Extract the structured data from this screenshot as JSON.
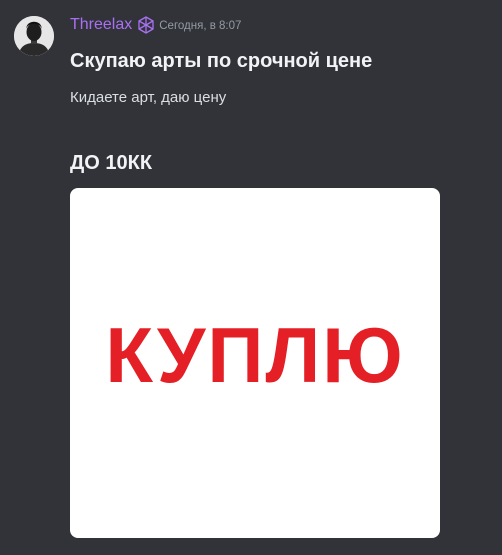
{
  "colors": {
    "background": "#313338",
    "username": "#a970f3",
    "image_text": "#e41f26"
  },
  "message": {
    "author": {
      "name": "Threelax",
      "avatar_icon": "avatar-photo",
      "role_icon": "crystal-role-icon"
    },
    "timestamp": "Сегодня, в 8:07",
    "title": "Скупаю арты по срочной цене",
    "subtitle": "Кидаете арт, даю цену",
    "heading": "ДО 10КК",
    "attachment": {
      "text": "КУПЛЮ"
    }
  }
}
